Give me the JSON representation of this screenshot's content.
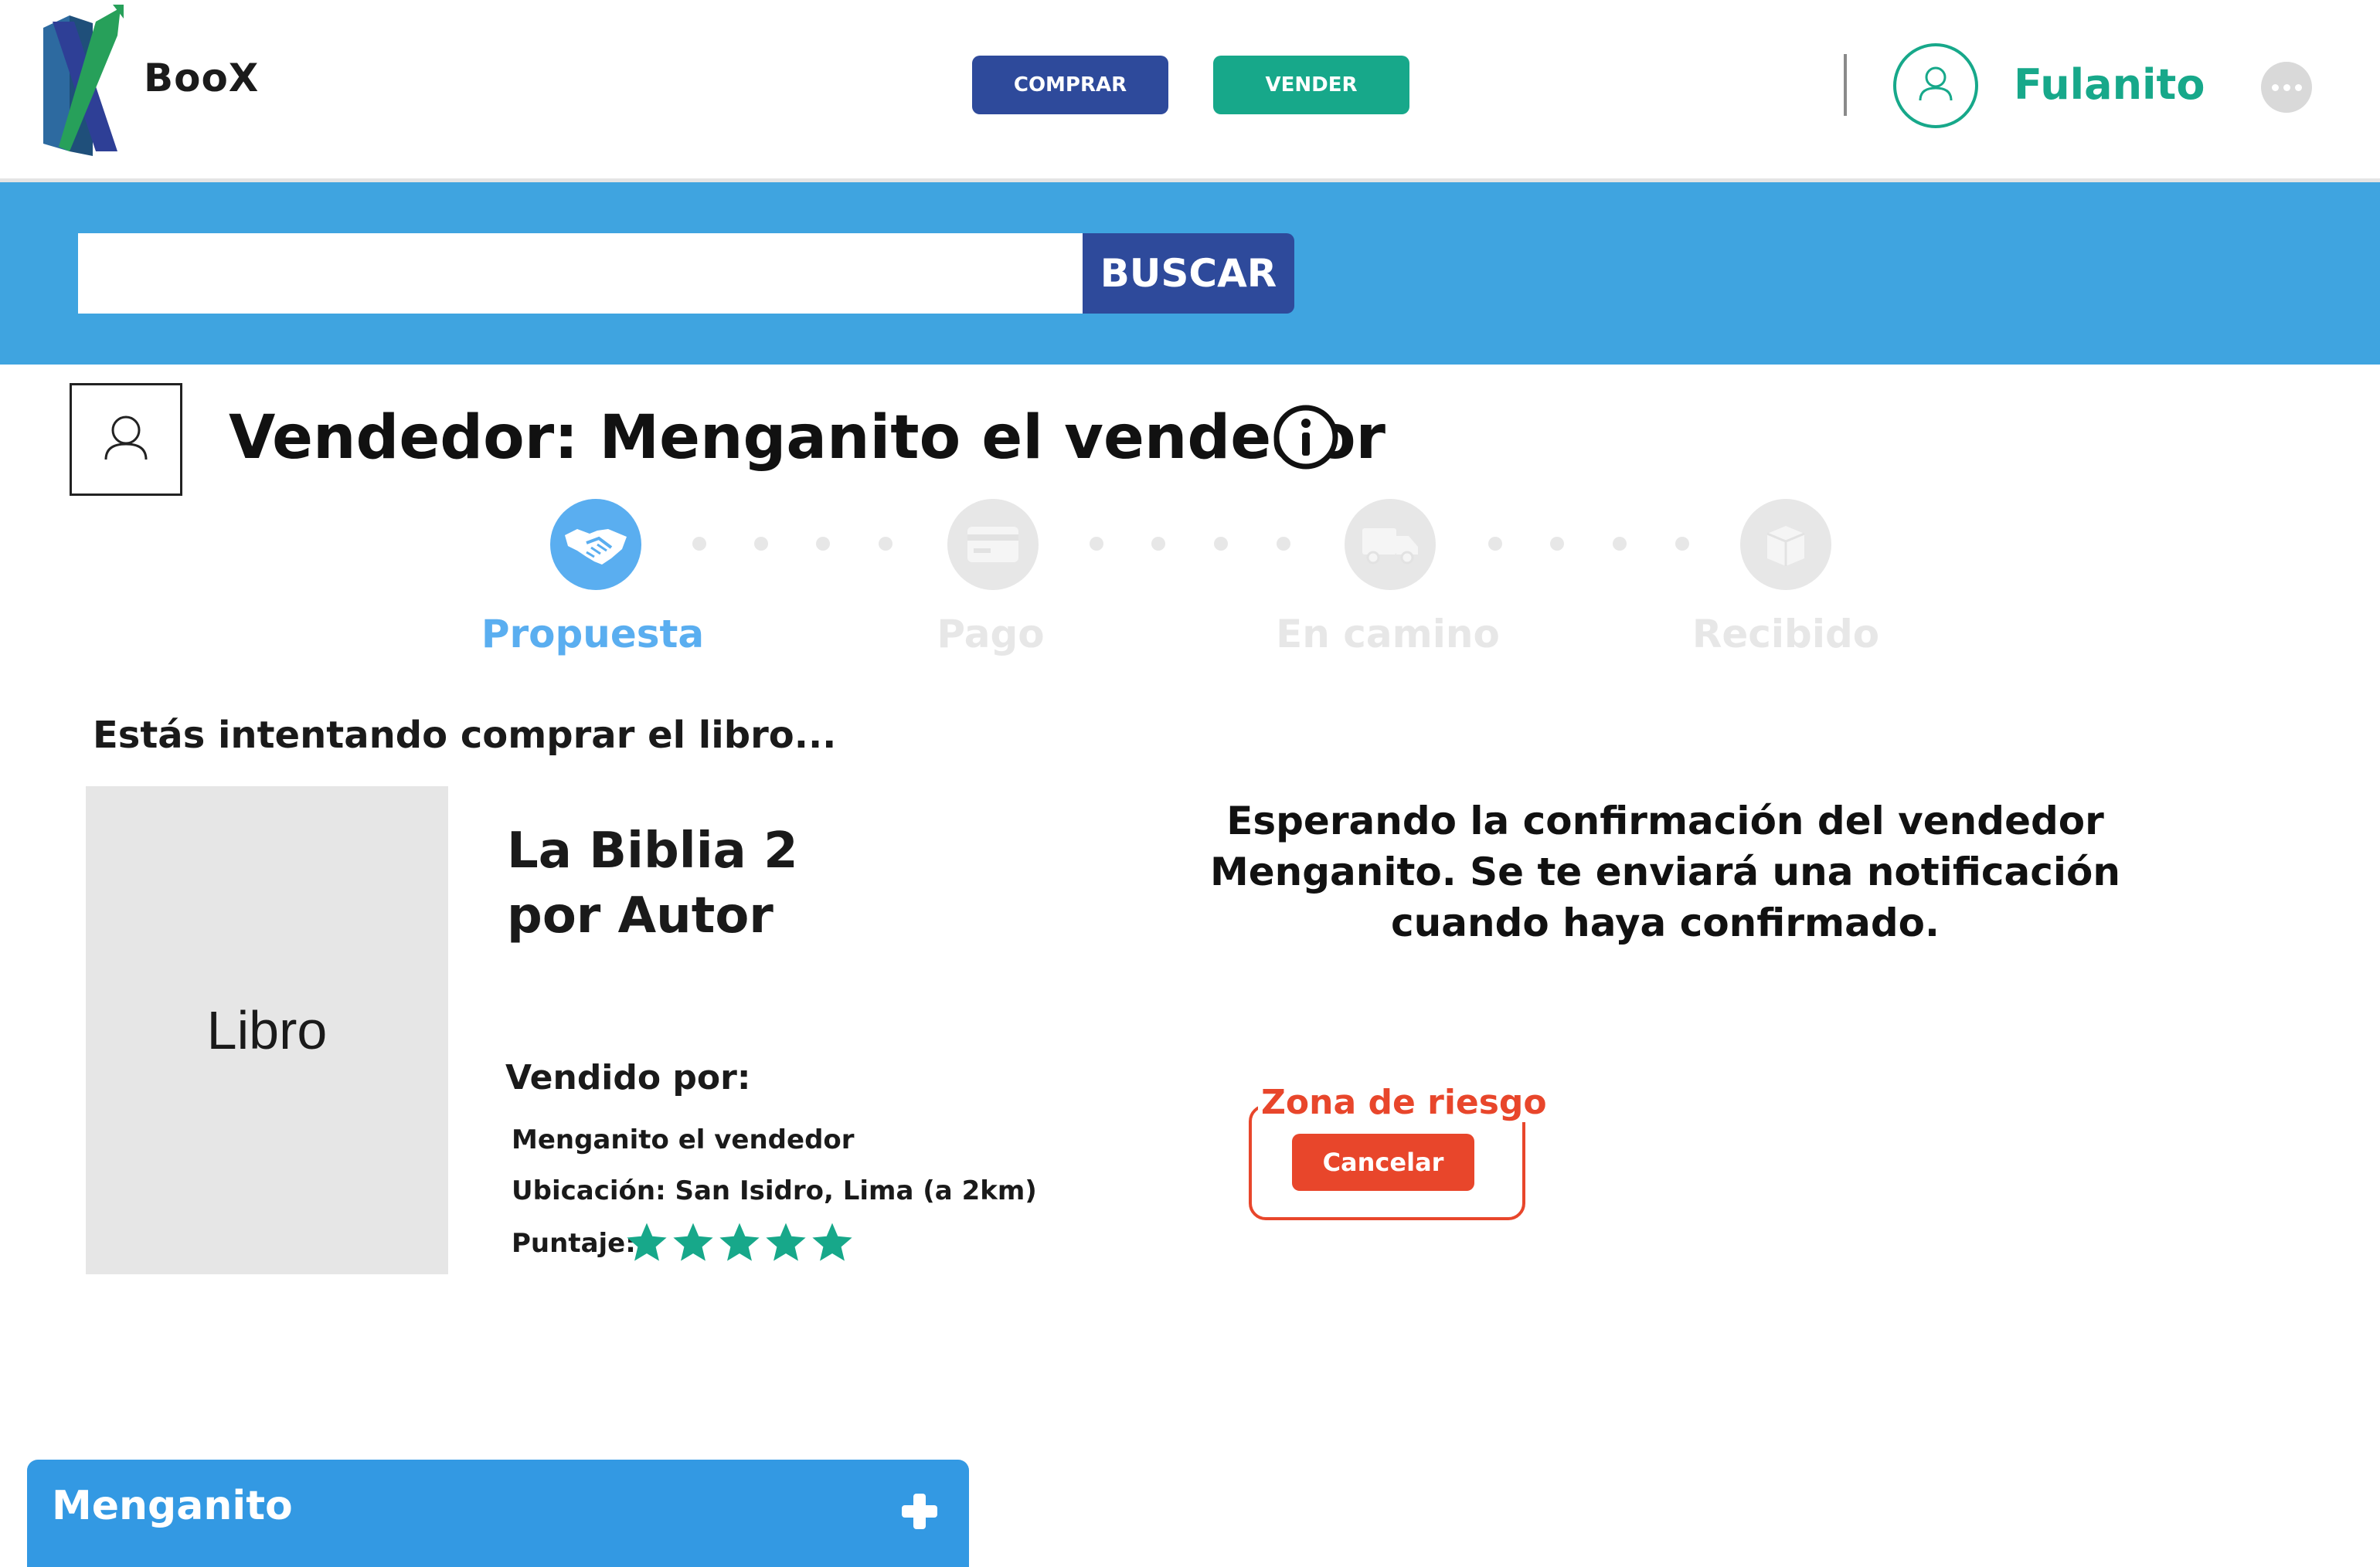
{
  "header": {
    "brand": "BooX",
    "buy_label": "COMPRAR",
    "sell_label": "VENDER",
    "user_name": "Fulanito",
    "colors": {
      "buy": "#2e4a9b",
      "sell": "#17a88a",
      "accent": "#17a88a"
    }
  },
  "search": {
    "value": "",
    "button_label": "BUSCAR",
    "band_color": "#3fa4e0"
  },
  "seller_header": {
    "title": "Vendedor: Menganito el vendedor",
    "info_icon": "info-icon"
  },
  "progress": {
    "current_step": 0,
    "steps": [
      {
        "label": "Propuesta",
        "icon": "handshake-icon",
        "active": true
      },
      {
        "label": "Pago",
        "icon": "credit-card-icon",
        "active": false
      },
      {
        "label": "En camino",
        "icon": "truck-icon",
        "active": false
      },
      {
        "label": "Recibido",
        "icon": "box-icon",
        "active": false
      }
    ],
    "active_color": "#5aaef0",
    "inactive_color": "#e7e7e7"
  },
  "purchase": {
    "intro": "Estás intentando comprar el libro...",
    "cover_placeholder": "Libro",
    "title_line1": "La Biblia 2",
    "title_line2": "por Autor",
    "sold_by_label": "Vendido por:",
    "seller_name": "Menganito el vendedor",
    "location": "Ubicación: San Isidro, Lima (a 2km)",
    "rating_label": "Puntaje:",
    "rating": 5,
    "rating_max": 5
  },
  "status": {
    "message": "Esperando la confirmación del vendedor Menganito. Se te enviará una notificación cuando haya confirmado."
  },
  "risk_zone": {
    "label": "Zona de riesgo",
    "cancel_label": "Cancelar",
    "color": "#e8462b"
  },
  "chat": {
    "contact_name": "Menganito",
    "color": "#3399e3"
  }
}
